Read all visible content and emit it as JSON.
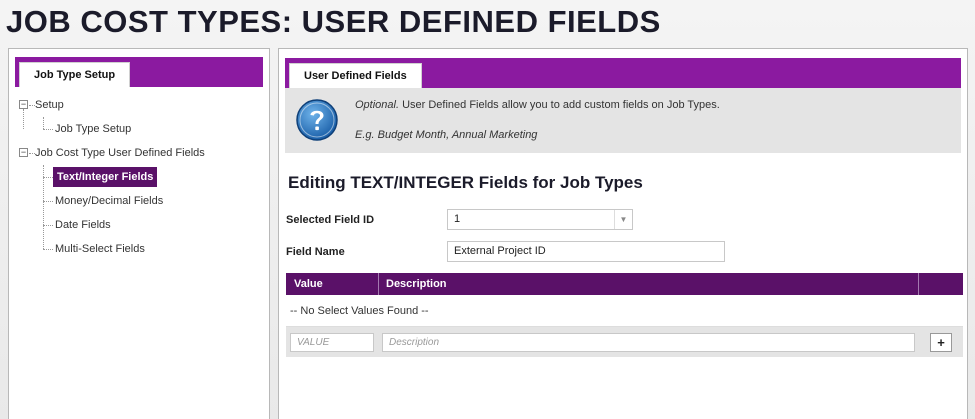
{
  "page": {
    "title": "JOB COST TYPES: USER DEFINED FIELDS"
  },
  "left": {
    "tab_label": "Job Type Setup",
    "tree": [
      {
        "label": "Setup",
        "level": 0,
        "toggle": "−"
      },
      {
        "label": "Job Type Setup",
        "level": 1
      },
      {
        "label": "Job Cost Type User Defined Fields",
        "level": 0,
        "toggle": "−"
      },
      {
        "label": "Text/Integer Fields",
        "level": 1,
        "selected": true
      },
      {
        "label": "Money/Decimal Fields",
        "level": 1
      },
      {
        "label": "Date Fields",
        "level": 1
      },
      {
        "label": "Multi-Select Fields",
        "level": 1
      }
    ]
  },
  "right": {
    "tab_label": "User Defined Fields",
    "info": {
      "optional": "Optional.",
      "line1_rest": " User Defined Fields allow you to add custom fields on Job Types.",
      "line2": "E.g. Budget Month, Annual Marketing",
      "icon": "help-icon"
    },
    "heading": "Editing TEXT/INTEGER Fields for Job Types",
    "selected_field_label": "Selected Field ID",
    "selected_field_value": "1",
    "field_name_label": "Field Name",
    "field_name_value": "External Project ID",
    "table": {
      "columns": [
        "Value",
        "Description"
      ],
      "empty_text": "-- No Select Values Found --",
      "value_placeholder": "VALUE",
      "description_placeholder": "Description",
      "add_label": "+"
    }
  },
  "colors": {
    "accent": "#8b1aa0",
    "dark_accent": "#5a1168"
  }
}
